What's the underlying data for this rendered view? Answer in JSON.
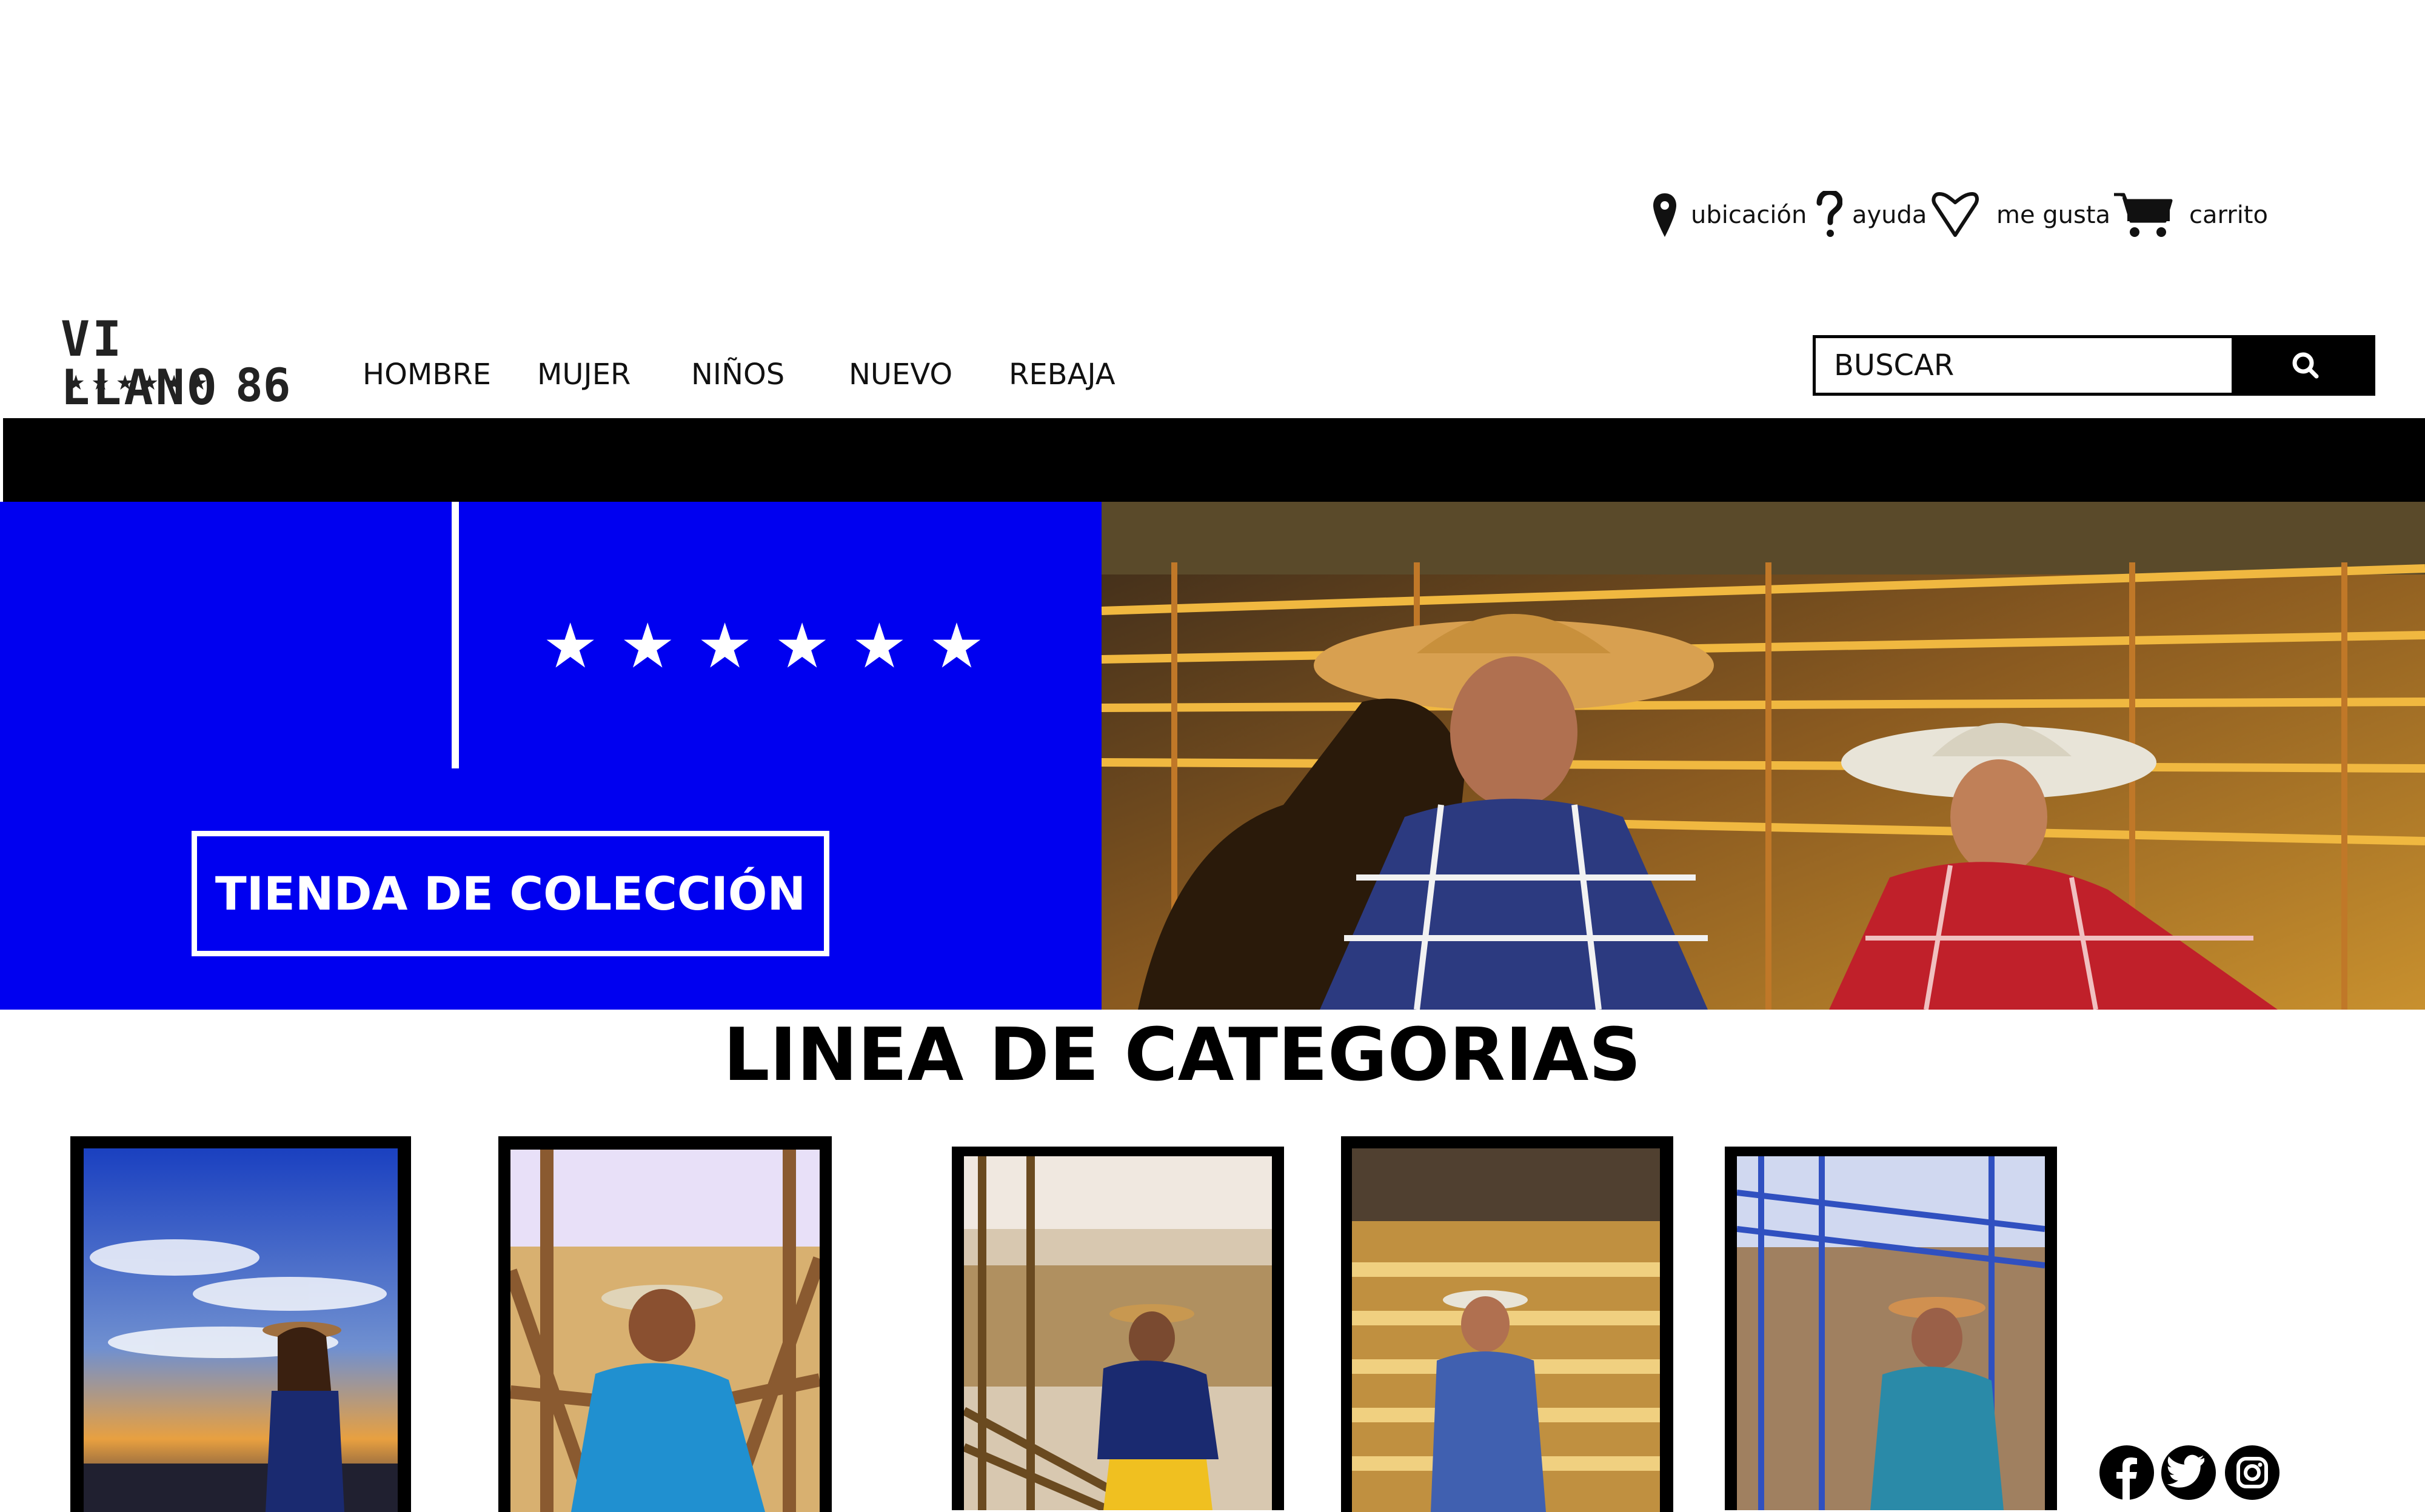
{
  "utility_nav": [
    {
      "label": "ubicación",
      "icon": "location-pin-icon"
    },
    {
      "label": "ayuda",
      "icon": "question-mark-icon"
    },
    {
      "label": "me gusta",
      "icon": "heart-icon"
    },
    {
      "label": "carrito",
      "icon": "cart-icon"
    }
  ],
  "logo": {
    "text": "VI LLANO",
    "stars": "★★★★★★",
    "number": "86"
  },
  "main_nav": [
    {
      "label": "HOMBRE"
    },
    {
      "label": "MUJER"
    },
    {
      "label": "NIÑOS"
    },
    {
      "label": "NUEVO"
    },
    {
      "label": "REBAJA"
    }
  ],
  "search": {
    "placeholder": "BUSCAR",
    "button_icon": "search-icon"
  },
  "hero": {
    "stars": "★★★★★★",
    "cta_label": "TIENDA DE COLECCIÓN",
    "accent_color": "#0000f0"
  },
  "categories": {
    "title": "LINEA DE CATEGORIAS",
    "items": [
      {
        "image": "girl-sunset-sky-photo"
      },
      {
        "image": "boy-blue-shirt-corral-photo"
      },
      {
        "image": "girl-plaid-shirt-rodeo-photo"
      },
      {
        "image": "boy-checked-shirt-logs-photo"
      },
      {
        "image": "girl-denim-shirt-arena-photo"
      }
    ]
  },
  "social": [
    {
      "icon": "facebook-icon",
      "glyph": "f"
    },
    {
      "icon": "twitter-icon",
      "glyph": ""
    },
    {
      "icon": "instagram-icon",
      "glyph": ""
    }
  ]
}
